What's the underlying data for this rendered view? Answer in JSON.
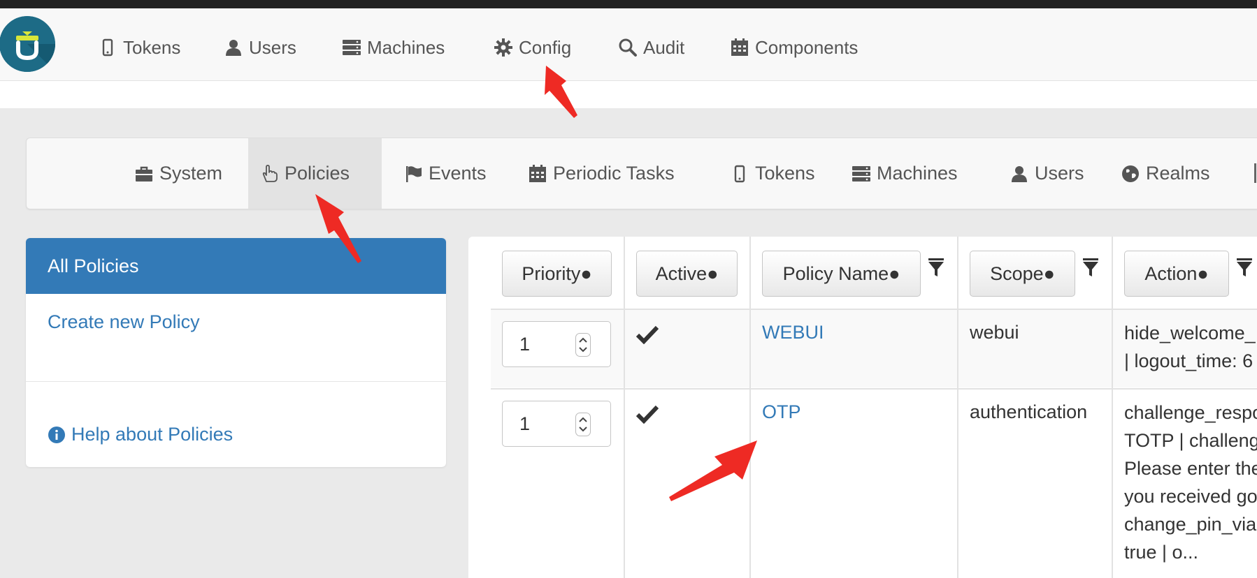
{
  "colors": {
    "primary": "#337ab7",
    "annotation_arrow": "#ee2a24",
    "active_tab_bg": "#e3e3e3"
  },
  "top_nav": {
    "logo_icon": "privacyidea-logo-icon",
    "items": [
      {
        "label": "Tokens",
        "icon": "mobile-icon"
      },
      {
        "label": "Users",
        "icon": "user-icon"
      },
      {
        "label": "Machines",
        "icon": "server-icon"
      },
      {
        "label": "Config",
        "icon": "gear-icon"
      },
      {
        "label": "Audit",
        "icon": "search-icon"
      },
      {
        "label": "Components",
        "icon": "calendar-icon"
      }
    ]
  },
  "config_nav": {
    "items": [
      {
        "label": "System",
        "icon": "briefcase-icon"
      },
      {
        "label": "Policies",
        "icon": "hand-pointer-icon",
        "active": true
      },
      {
        "label": "Events",
        "icon": "flag-icon"
      },
      {
        "label": "Periodic Tasks",
        "icon": "calendar-icon"
      },
      {
        "label": "Tokens",
        "icon": "mobile-icon"
      },
      {
        "label": "Machines",
        "icon": "server-icon"
      },
      {
        "label": "Users",
        "icon": "user-icon"
      },
      {
        "label": "Realms",
        "icon": "globe-icon"
      }
    ]
  },
  "sidebar": {
    "active_item": "All Policies",
    "create_link": "Create new Policy",
    "help_link": "Help about Policies",
    "help_icon": "info-circle-icon"
  },
  "policy_table": {
    "headers": {
      "priority": "Priority●",
      "active": "Active●",
      "name": "Policy Name●",
      "scope": "Scope●",
      "action": "Action●"
    },
    "filter_icon": "filter-icon",
    "rows": [
      {
        "priority": "1",
        "active": true,
        "name": "WEBUI",
        "scope": "webui",
        "action_lines": [
          "hide_welcome_",
          "| logout_time: 6"
        ]
      },
      {
        "priority": "1",
        "active": true,
        "name": "OTP",
        "scope": "authentication",
        "action_lines": [
          "challenge_respo",
          "TOTP | challeng",
          "Please enter the",
          "you received go",
          "change_pin_via",
          "true | o..."
        ]
      }
    ]
  }
}
